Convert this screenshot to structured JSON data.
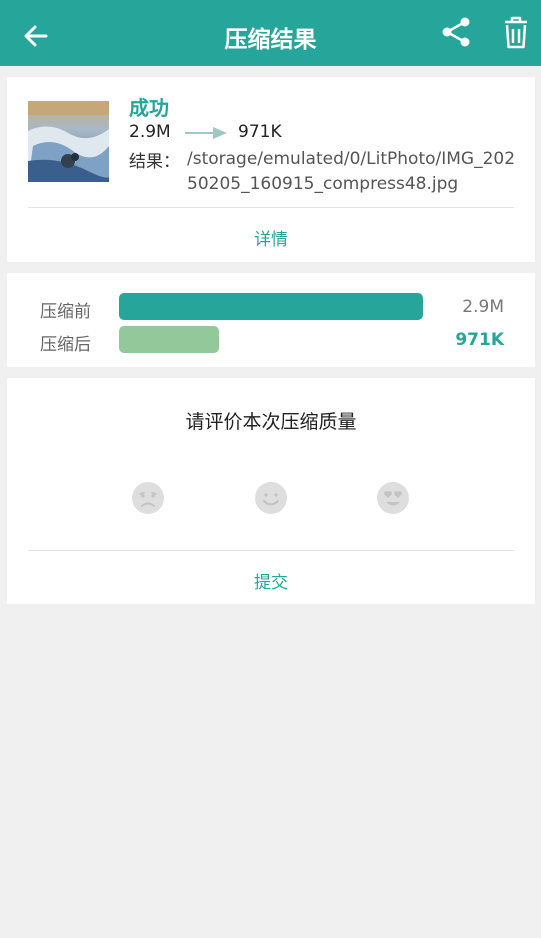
{
  "appbar": {
    "title": "压缩结果",
    "back_icon": "arrow-back-icon",
    "share_icon": "share-icon",
    "delete_icon": "trash-icon"
  },
  "result": {
    "status": "成功",
    "original_size": "2.9M",
    "compressed_size": "971K",
    "result_label": "结果：",
    "result_path": "/storage/emulated/0/LitPhoto/IMG_20250205_160915_compress48.jpg",
    "details_label": "详情"
  },
  "comparison": {
    "before_label": "压缩前",
    "before_value": "2.9M",
    "before_fraction": 1.0,
    "after_label": "压缩后",
    "after_value": "971K",
    "after_fraction": 0.33
  },
  "rating": {
    "prompt": "请评价本次压缩质量",
    "options": [
      "sad-face-icon",
      "smile-face-icon",
      "heart-eyes-face-icon"
    ],
    "submit_label": "提交"
  },
  "colors": {
    "accent": "#26a69a",
    "after_bar": "#93c99a",
    "background": "#f0f0f0"
  }
}
